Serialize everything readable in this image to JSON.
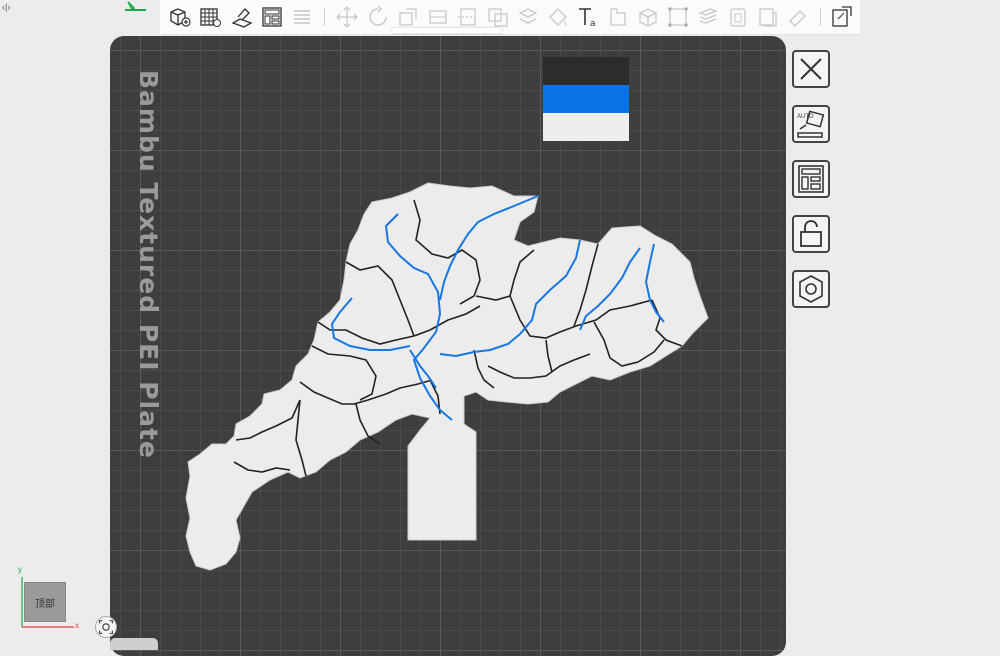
{
  "colors": {
    "plate": "#3e3e3e",
    "map_fill": "#ececec",
    "border_lines": "#222222",
    "rivers": "#1677e6",
    "accent_green": "#19a84a"
  },
  "plate": {
    "label": "Bambu Textured PEI Plate"
  },
  "filament_swatches": [
    "#2c2c2c",
    "#0a73e6",
    "#eeeeee"
  ],
  "toolbar": {
    "icons": [
      "add-cube-icon",
      "grid-icon",
      "auto-orient-icon",
      "arrange-icon",
      "layers-icon",
      "move-icon",
      "rotate-icon",
      "scale-icon",
      "lay-on-face-icon",
      "cut-icon",
      "boolean-icon",
      "split-icon",
      "paint-icon",
      "seam-icon",
      "text-icon",
      "measure-icon",
      "assembly-icon",
      "support-icon",
      "variable-layer-icon",
      "clone-icon",
      "copy-icon",
      "eraser-icon",
      "settings-icon"
    ]
  },
  "right_panel": {
    "buttons": [
      "close-icon",
      "auto-place-icon",
      "layout-icon",
      "lock-icon",
      "nut-icon"
    ],
    "auto_label": "AUTO"
  },
  "view_cube": {
    "label": "顶部",
    "axis_x": "x",
    "axis_y": "y"
  }
}
